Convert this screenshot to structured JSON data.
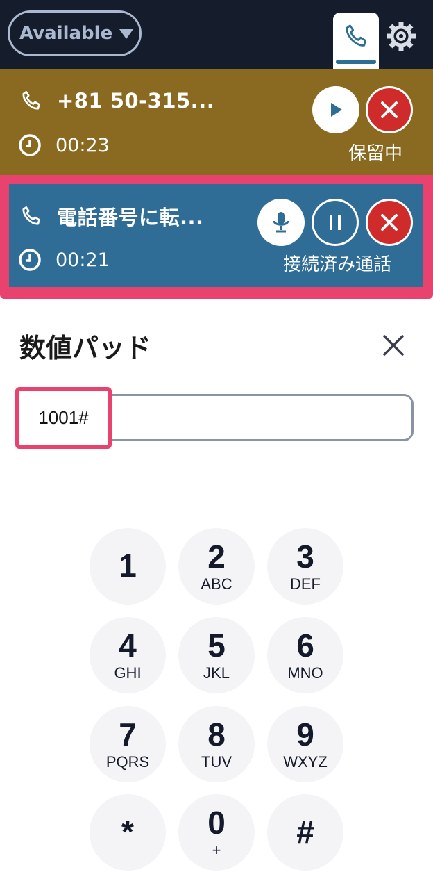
{
  "header": {
    "status_label": "Available",
    "icons": {
      "status_caret": "caret-down-icon",
      "phone_tab": "phone-icon",
      "settings": "gear-icon"
    }
  },
  "calls": {
    "on_hold": {
      "number": "+81 50-315...",
      "timer": "00:23",
      "state": "保留中",
      "bg_color": "#8a6a21"
    },
    "connected": {
      "number": "電話番号に転...",
      "timer": "00:21",
      "state": "接続済み通話",
      "bg_color": "#2f6d96"
    }
  },
  "keypad": {
    "title": "数値パッド",
    "input_value": "1001#",
    "keys": [
      {
        "digit": "1",
        "letters": ""
      },
      {
        "digit": "2",
        "letters": "ABC"
      },
      {
        "digit": "3",
        "letters": "DEF"
      },
      {
        "digit": "4",
        "letters": "GHI"
      },
      {
        "digit": "5",
        "letters": "JKL"
      },
      {
        "digit": "6",
        "letters": "MNO"
      },
      {
        "digit": "7",
        "letters": "PQRS"
      },
      {
        "digit": "8",
        "letters": "TUV"
      },
      {
        "digit": "9",
        "letters": "WXYZ"
      },
      {
        "digit": "*",
        "letters": ""
      },
      {
        "digit": "0",
        "letters": "+"
      },
      {
        "digit": "#",
        "letters": ""
      }
    ]
  },
  "colors": {
    "highlight": "#e8436f",
    "topbar": "#151d2d",
    "end_call": "#cf2b2b"
  }
}
